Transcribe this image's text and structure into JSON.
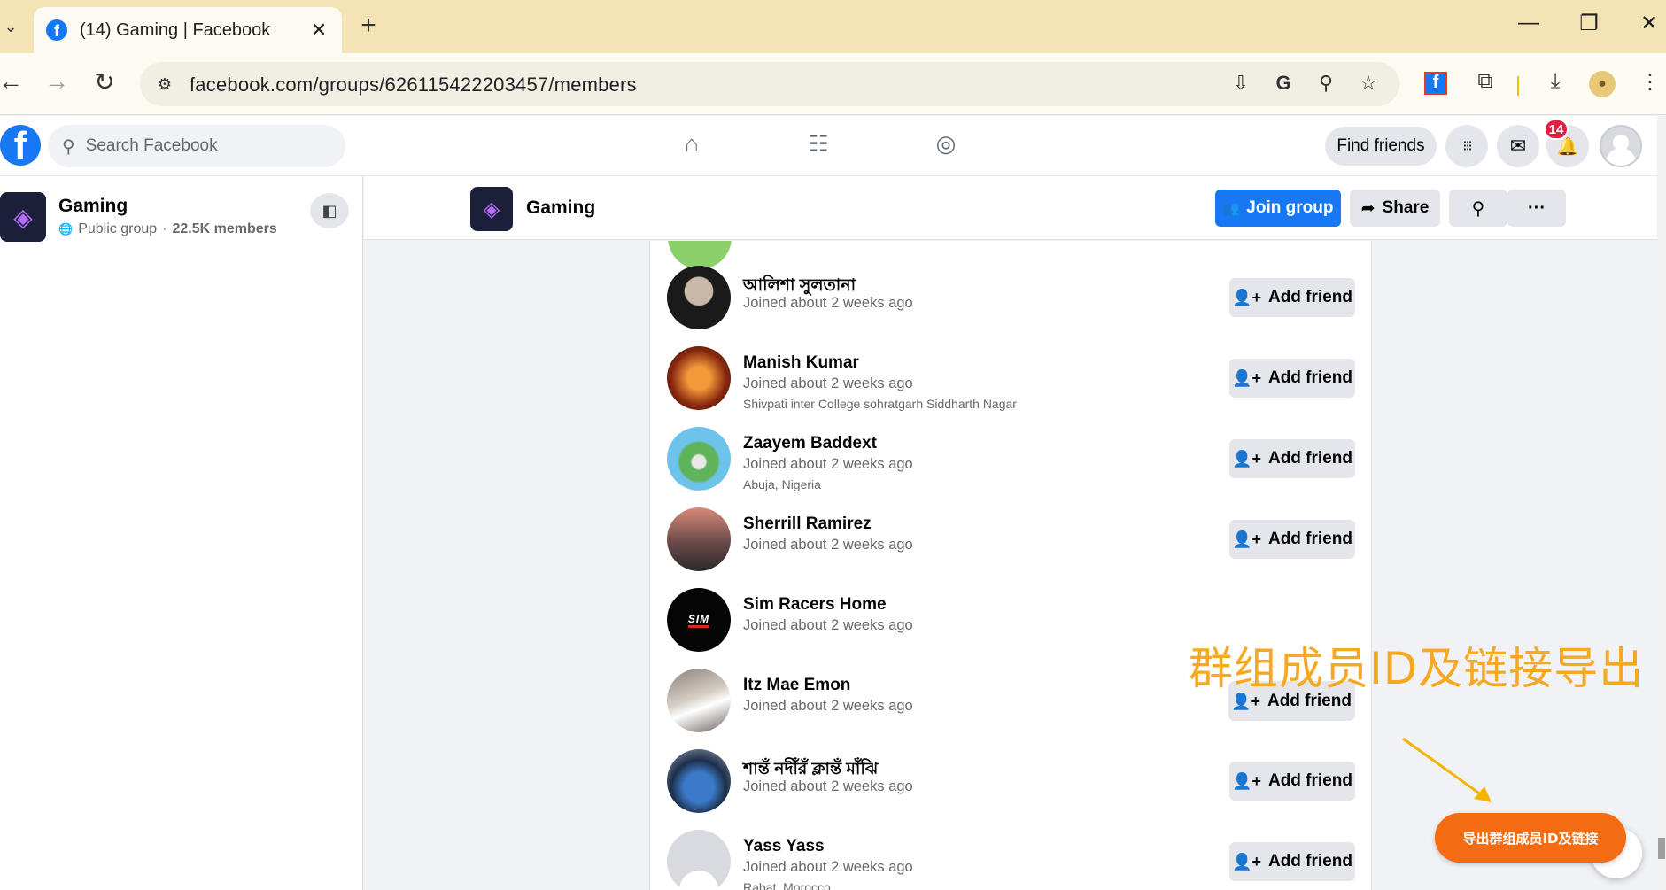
{
  "browser": {
    "tab_title": "(14) Gaming | Facebook",
    "url": "facebook.com/groups/626115422203457/members",
    "favicon_letter": "f",
    "icons": {
      "tab_dropdown": "chevron-down-icon",
      "tab_close": "close-icon",
      "new_tab": "plus-icon",
      "back": "back-arrow-icon",
      "forward": "forward-arrow-icon",
      "reload": "reload-icon",
      "site_info": "tune-icon",
      "install": "install-app-icon",
      "translate": "translate-icon",
      "zoom": "zoom-icon",
      "bookmark": "star-icon",
      "extensions": "puzzle-icon",
      "downloads": "download-icon",
      "menu": "kebab-menu-icon"
    },
    "symbols": {
      "chevron": "⌄",
      "close": "✕",
      "plus": "+",
      "minimize": "—",
      "restore": "❐",
      "back": "←",
      "forward": "→",
      "reload": "↻",
      "tune": "⚙",
      "install": "⇩",
      "translate": "G",
      "zoom": "⚲",
      "star": "☆",
      "puzzle": "⧉",
      "download": "⤓",
      "menu": "⋮",
      "profile": "●"
    }
  },
  "fb": {
    "logo_letter": "f",
    "search_placeholder": "Search Facebook",
    "find_friends_label": "Find friends",
    "notification_count": "14",
    "symbols": {
      "search": "⚲",
      "home": "⌂",
      "friends": "☷",
      "groups": "◎",
      "menu": "⁝⁝⁝",
      "messenger": "✉",
      "bell": "🔔"
    }
  },
  "sidebar": {
    "group_name": "Gaming",
    "privacy": "Public group",
    "separator": "·",
    "member_count": "22.5K members",
    "globe": "🌐",
    "toggle": "◧"
  },
  "group_header": {
    "title": "Gaming",
    "join_label": "Join group",
    "share_label": "Share",
    "join_icon": "👥",
    "share_icon": "➦",
    "search_icon": "⚲",
    "more_icon": "···"
  },
  "members": [
    {
      "name": "আলিশা সুলতানা",
      "joined": "Joined about 2 weeks ago",
      "location": "",
      "avatar_color": "#3a2f2f"
    },
    {
      "name": "Manish Kumar",
      "joined": "Joined about 2 weeks ago",
      "location": "Shivpati inter College sohratgarh Siddharth Nagar",
      "avatar_color": "#b8401a"
    },
    {
      "name": "Zaayem Baddext",
      "joined": "Joined about 2 weeks ago",
      "location": "Abuja, Nigeria",
      "avatar_color": "#3b8fd1"
    },
    {
      "name": "Sherrill Ramirez",
      "joined": "Joined about 2 weeks ago",
      "location": "",
      "avatar_color": "#8a5a5a"
    },
    {
      "name": "Sim Racers Home",
      "joined": "Joined about 2 weeks ago",
      "location": "",
      "avatar_color": "#050505"
    },
    {
      "name": "Itz Mae Emon",
      "joined": "Joined about 2 weeks ago",
      "location": "",
      "avatar_color": "#b9a99a"
    },
    {
      "name": "শান্তঁ নদীঁরঁ ক্লান্তঁ মাঁঝি",
      "joined": "Joined about 2 weeks ago",
      "location": "",
      "avatar_color": "#2f5d8a"
    },
    {
      "name": "Yass Yass",
      "joined": "Joined about 2 weeks ago",
      "location": "Rabat, Morocco",
      "avatar_color": "#d8dadf"
    }
  ],
  "add_friend_label": "Add friend",
  "add_friend_icon": "👤+",
  "sim_racers_logo_text": "SIM",
  "overlay": {
    "headline": "群组成员ID及链接导出",
    "button_label": "导出群组成员ID及链接",
    "accent_color": "#f36c12",
    "headline_color": "#f6a821"
  }
}
